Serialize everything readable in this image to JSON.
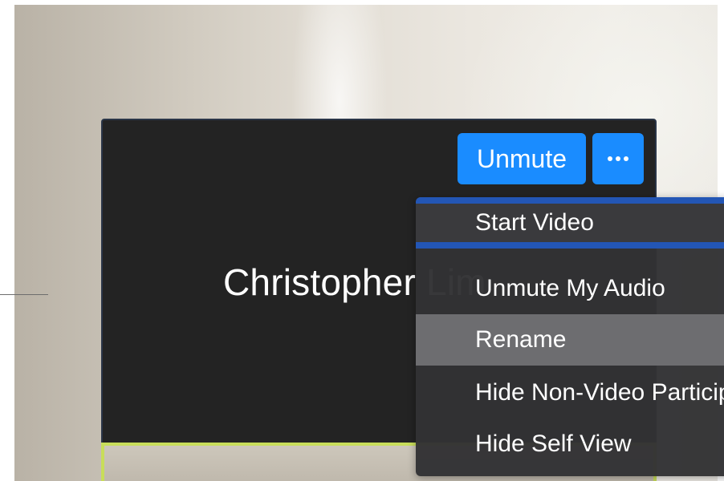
{
  "participant": {
    "name": "Christopher Lim"
  },
  "controls": {
    "unmute_label": "Unmute",
    "more_icon": "ellipsis-icon",
    "accent_color": "#1a8cff"
  },
  "context_menu": {
    "items": [
      {
        "label": "Start Video",
        "state": "focused"
      },
      {
        "label": "Unmute My Audio",
        "state": "normal"
      },
      {
        "label": "Rename",
        "state": "hovered"
      },
      {
        "label": "Hide Non-Video Participants",
        "state": "normal"
      },
      {
        "label": "Hide Self View",
        "state": "normal"
      }
    ]
  },
  "colors": {
    "tile_background": "#232323",
    "menu_background": "#323234",
    "focus_ring": "#2356b5",
    "active_speaker_border": "#c8dd5a"
  }
}
